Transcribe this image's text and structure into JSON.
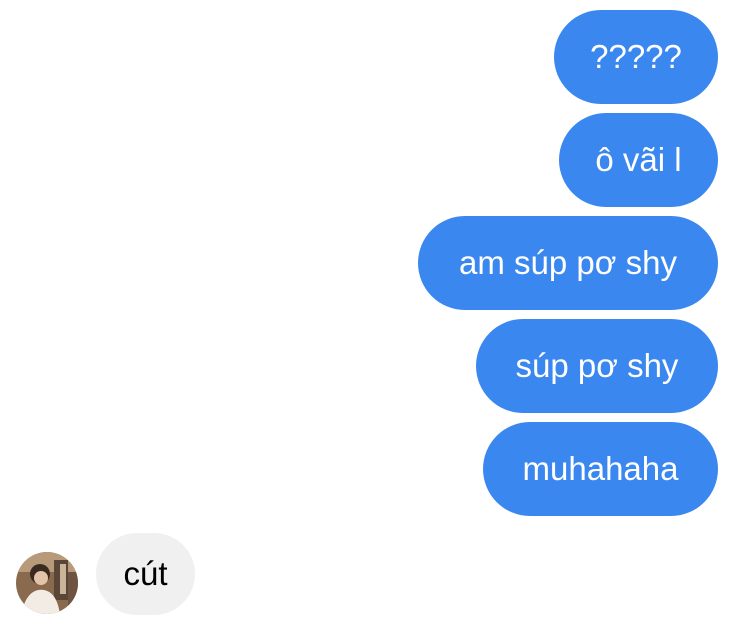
{
  "conversation": {
    "outgoing": [
      {
        "text": "?????"
      },
      {
        "text": "ô vãi l"
      },
      {
        "text": "am súp pơ shy"
      },
      {
        "text": "súp pơ shy"
      },
      {
        "text": "muhahaha"
      }
    ],
    "incoming": [
      {
        "text": "cút"
      }
    ]
  },
  "colors": {
    "outgoing_bubble": "#3b87f0",
    "incoming_bubble": "#f0f0f0"
  },
  "icons": {
    "avatar": "contact-avatar-photo"
  }
}
